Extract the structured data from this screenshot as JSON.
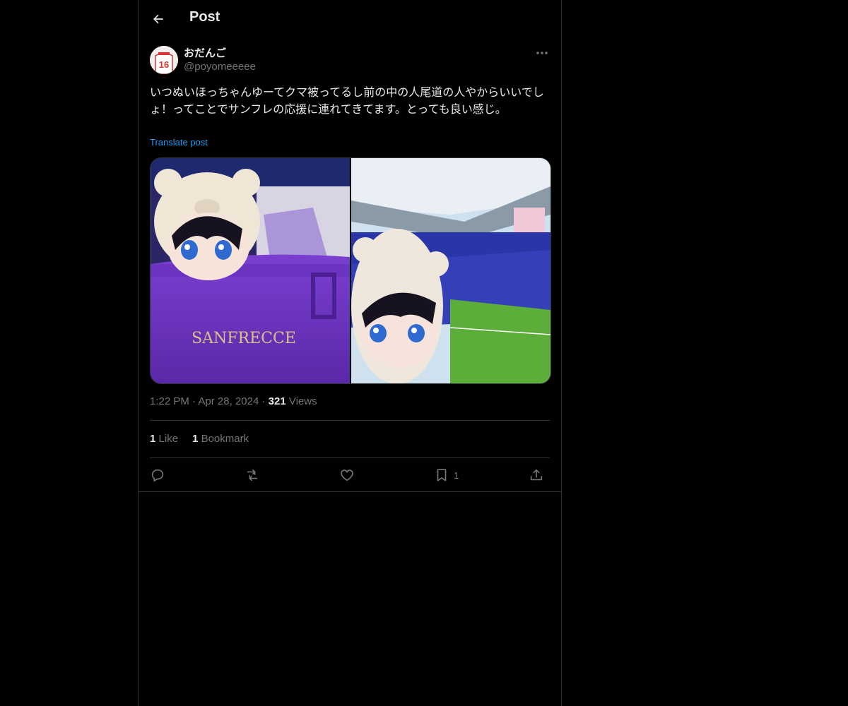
{
  "header": {
    "title": "Post",
    "back_icon": "arrow-left-icon"
  },
  "author": {
    "display_name": "おだんご",
    "handle": "@poyomeeeee",
    "avatar_label": "16"
  },
  "post": {
    "text": "いつぬいほっちゃんゆーてクマ被ってるし前の中の人尾道の人やからいいでしょ！ってことでサンフレの応援に連れてきてます。とっても良い感じ。",
    "translate_label": "Translate post",
    "media": [
      {
        "alt": "plush doll in bear hood inside purple bag",
        "bag_text": "SANFRECCE"
      },
      {
        "alt": "plush doll in bear hood at stadium"
      }
    ],
    "time": "1:22 PM",
    "date": "Apr 28, 2024",
    "views_count": "321",
    "views_label": "Views"
  },
  "stats": {
    "likes_count": "1",
    "likes_label": "Like",
    "bookmarks_count": "1",
    "bookmarks_label": "Bookmark"
  },
  "actions": {
    "reply_icon": "reply-icon",
    "repost_icon": "repost-icon",
    "like_icon": "heart-icon",
    "bookmark_icon": "bookmark-icon",
    "bookmark_count": "1",
    "share_icon": "share-icon"
  },
  "colors": {
    "background": "#000000",
    "text": "#e7e9ea",
    "muted": "#71767b",
    "accent": "#1d9bf0",
    "border": "#2f3336"
  }
}
